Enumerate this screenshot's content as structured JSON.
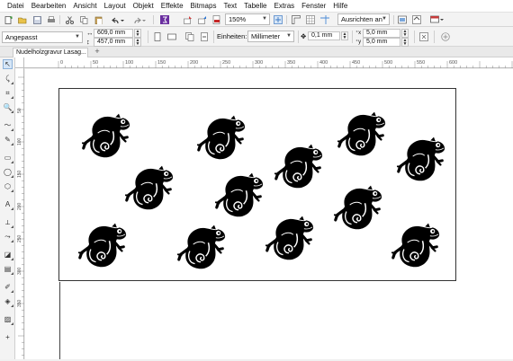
{
  "menu": [
    "Datei",
    "Bearbeiten",
    "Ansicht",
    "Layout",
    "Objekt",
    "Effekte",
    "Bitmaps",
    "Text",
    "Tabelle",
    "Extras",
    "Fenster",
    "Hilfe"
  ],
  "toolbar": {
    "zoom_value": "150%",
    "snap_label": "Ausrichten an",
    "icons": [
      "new-icon",
      "open-icon",
      "save-icon",
      "print-icon",
      "cut-icon",
      "copy-icon",
      "paste-icon",
      "undo-icon",
      "redo-icon",
      "search-content-icon",
      "import-icon",
      "export-icon",
      "publish-pdf-icon",
      "fullscreen-icon",
      "rulers-icon",
      "grid-icon",
      "options-icon",
      "launch-icon"
    ]
  },
  "property_bar": {
    "preset": "Angepasst",
    "width": "609,0 mm",
    "height": "457,0 mm",
    "units_label": "Einheiten:",
    "units_value": "Millimeter",
    "nudge": "0,1 mm",
    "duplicate_x": "5,0 mm",
    "duplicate_y": "5,0 mm"
  },
  "document_tab": {
    "title": "Nudelholzgravur Lasag..."
  },
  "ruler": {
    "h_labels": [
      "0",
      "50",
      "100",
      "150",
      "200",
      "250",
      "300",
      "350",
      "400",
      "450",
      "500",
      "550",
      "600"
    ],
    "v_labels": [
      "50",
      "100",
      "150",
      "200",
      "250",
      "300",
      "350"
    ]
  },
  "tools": [
    "pick-tool-icon",
    "shape-tool-icon",
    "crop-tool-icon",
    "zoom-tool-icon",
    "freehand-tool-icon",
    "artistic-media-icon",
    "rectangle-tool-icon",
    "ellipse-tool-icon",
    "polygon-tool-icon",
    "text-tool-icon",
    "parallel-dimension-icon",
    "connector-tool-icon",
    "drop-shadow-icon",
    "transparency-icon",
    "eyedropper-icon",
    "interactive-fill-icon",
    "smart-fill-icon",
    "add-tool-icon"
  ],
  "canvas": {
    "chameleon_count": 12
  }
}
